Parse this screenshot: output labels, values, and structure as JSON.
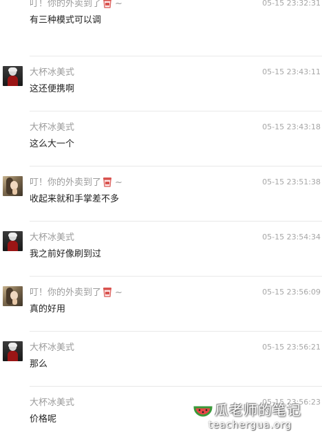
{
  "messages": [
    {
      "avatar": "none",
      "name": "叮！你的外卖到了",
      "badge": "drink-cup-icon",
      "suffix": "~",
      "time": "05-15 23:32:31",
      "text": "有三种模式可以调"
    },
    {
      "avatar": "a",
      "name": "大杯冰美式",
      "badge": "",
      "suffix": "",
      "time": "05-15 23:43:11",
      "text": "这还便携啊"
    },
    {
      "avatar": "none",
      "name": "大杯冰美式",
      "badge": "",
      "suffix": "",
      "time": "05-15 23:43:18",
      "text": "这么大一个"
    },
    {
      "avatar": "b",
      "name": "叮！你的外卖到了",
      "badge": "drink-cup-icon",
      "suffix": "~",
      "time": "05-15 23:51:38",
      "text": "收起来就和手掌差不多"
    },
    {
      "avatar": "a",
      "name": "大杯冰美式",
      "badge": "",
      "suffix": "",
      "time": "05-15 23:54:34",
      "text": "我之前好像刷到过"
    },
    {
      "avatar": "b",
      "name": "叮！你的外卖到了",
      "badge": "drink-cup-icon",
      "suffix": "~",
      "time": "05-15 23:56:09",
      "text": "真的好用"
    },
    {
      "avatar": "a",
      "name": "大杯冰美式",
      "badge": "",
      "suffix": "",
      "time": "05-15 23:56:21",
      "text": "那么"
    },
    {
      "avatar": "none",
      "name": "大杯冰美式",
      "badge": "",
      "suffix": "",
      "time": "05-15 23:56:23",
      "text": "价格呢"
    }
  ],
  "watermark": {
    "title": "瓜老师的笔记",
    "url": "teachergua.org",
    "logo": "watermelon-icon"
  },
  "colors": {
    "name": "#9b9b9b",
    "time": "#a6a6a6",
    "text": "#222222",
    "divider": "#e8e8e8",
    "cup": "#d9534f"
  }
}
